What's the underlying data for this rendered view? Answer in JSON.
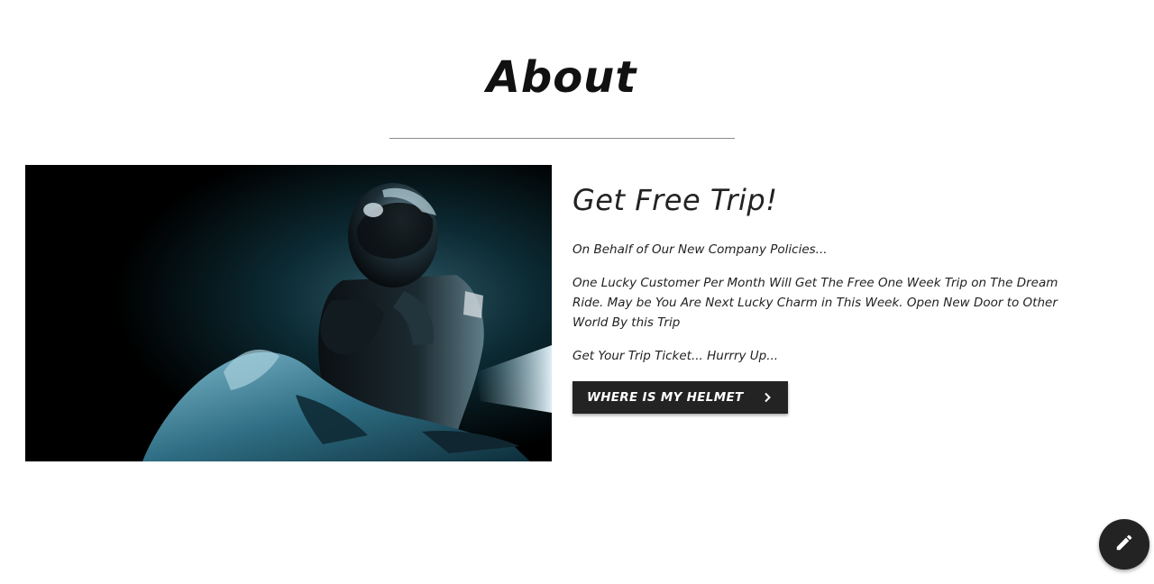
{
  "section": {
    "title": "About"
  },
  "hero_image": {
    "alt": "motorcyclist-with-helmet-on-blue-sportbike"
  },
  "content": {
    "heading": "Get Free Trip!",
    "paragraphs": [
      "On Behalf of Our New Company Policies...",
      "One Lucky Customer Per Month Will Get The Free One Week Trip on The Dream Ride. May be You Are Next Lucky Charm in This Week. Open New Door to Other World By this Trip",
      "Get Your Trip Ticket... Hurrry Up..."
    ],
    "cta_label": "WHERE IS MY HELMET"
  },
  "fab": {
    "icon": "pencil-icon"
  },
  "colors": {
    "background": "#ffffff",
    "button": "#232323",
    "text": "#222222",
    "divider": "#8c8c8c"
  }
}
